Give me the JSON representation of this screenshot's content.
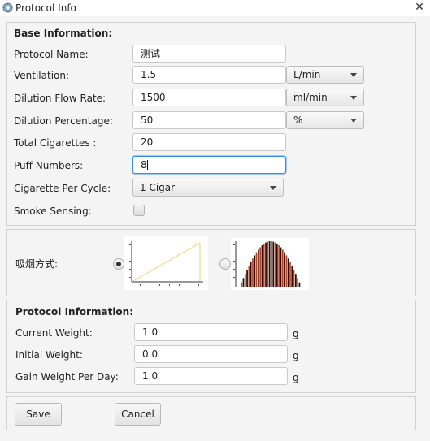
{
  "window": {
    "title": "Protocol Info",
    "close_glyph": "✕",
    "icon": "gear-icon"
  },
  "base_info": {
    "title": "Base Information:",
    "protocol_name": {
      "label": "Protocol Name:",
      "value": "测试"
    },
    "ventilation": {
      "label": "Ventilation:",
      "value": "1.5",
      "unit": "L/min"
    },
    "dilution_flow_rate": {
      "label": "Dilution Flow Rate:",
      "value": "1500",
      "unit": "ml/min"
    },
    "dilution_percentage": {
      "label": "Dilution Percentage:",
      "value": "50",
      "unit": "%"
    },
    "total_cigarettes": {
      "label": "Total Cigarettes :",
      "value": "20"
    },
    "puff_numbers": {
      "label": "Puff Numbers:",
      "value": "8"
    },
    "cigarette_per_cycle": {
      "label": "Cigarette Per Cycle:",
      "value": "1 Cigar"
    },
    "smoke_sensing": {
      "label": "Smoke  Sensing:",
      "checked": false
    }
  },
  "smoking_mode": {
    "label": "吸烟方式:",
    "options": [
      {
        "icon": "linear-profile-chart-thumbnail",
        "selected": true
      },
      {
        "icon": "bell-curve-bar-chart-thumbnail",
        "selected": false
      }
    ]
  },
  "protocol_info": {
    "title": "Protocol Information:",
    "current_weight": {
      "label": "Current Weight:",
      "value": "1.0",
      "unit": "g"
    },
    "initial_weight": {
      "label": "Initial Weight:",
      "value": "0.0",
      "unit": "g"
    },
    "gain_weight_per_day": {
      "label": "Gain Weight Per Day:",
      "value": "1.0",
      "unit": "g"
    }
  },
  "actions": {
    "save": "Save",
    "cancel": "Cancel"
  },
  "colors": {
    "focus": "#3a8ee0",
    "bar_dark": "#2a0a05",
    "bar_red": "#c0401e"
  }
}
